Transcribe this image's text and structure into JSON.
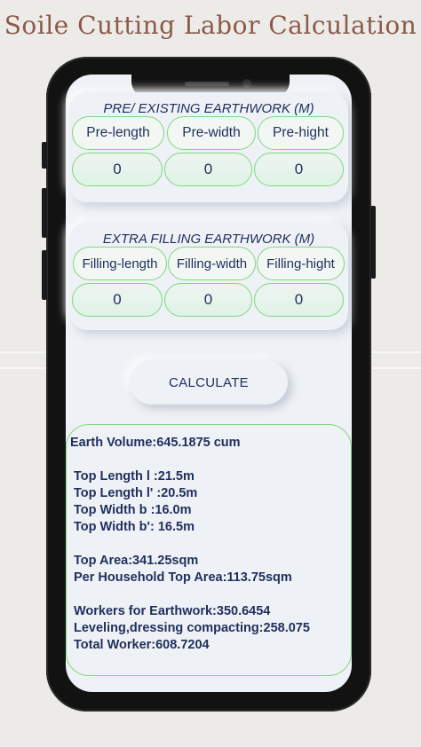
{
  "promo": {
    "title": "Soile Cutting Labor Calculation"
  },
  "existing_section": {
    "title": "PRE/ EXISTING EARTHWORK (M)",
    "labels": [
      "Pre-length",
      "Pre-width",
      "Pre-hight"
    ],
    "values": [
      "0",
      "0",
      "0"
    ]
  },
  "filling_section": {
    "title": "EXTRA FILLING EARTHWORK (M)",
    "labels": [
      "Filling-length",
      "Filling-width",
      "Filling-hight"
    ],
    "values": [
      "0",
      "0",
      "0"
    ]
  },
  "calculate_label": "CALCULATE",
  "results": {
    "earth_volume": "Earth Volume:645.1875 cum",
    "top_length_l": "Top Length l :21.5m",
    "top_length_l_prime": "Top Length l' :20.5m",
    "top_width_b": "Top Width b :16.0m",
    "top_width_b_prime": "Top Width b': 16.5m",
    "top_area": "Top Area:341.25sqm",
    "household_top_area": "Per Household Top Area:113.75sqm",
    "workers_earthwork": "Workers for Earthwork:350.6454",
    "leveling": "Leveling,dressing compacting:258.075",
    "total_worker": "Total Worker:608.7204"
  },
  "colors": {
    "title_brown": "#8b5a48",
    "text_navy": "#1e2f5c",
    "accent_green": "#7fd87f",
    "screen_bg": "#eef1f5"
  }
}
